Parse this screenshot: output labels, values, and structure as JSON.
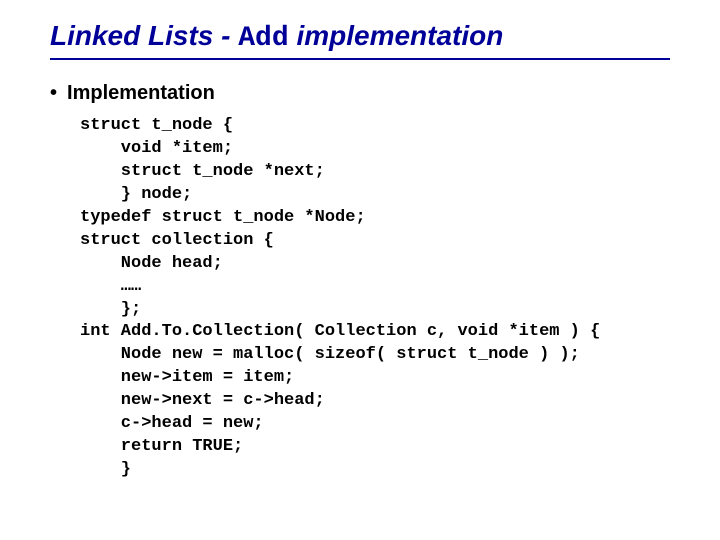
{
  "title": {
    "prefix": "Linked Lists - ",
    "mono": "Add",
    "suffix": " implementation"
  },
  "bullet": "Implementation",
  "code": "struct t_node {\n    void *item;\n    struct t_node *next;\n    } node;\ntypedef struct t_node *Node;\nstruct collection {\n    Node head;\n    ……\n    };\nint Add.To.Collection( Collection c, void *item ) {\n    Node new = malloc( sizeof( struct t_node ) );\n    new->item = item;\n    new->next = c->head;\n    c->head = new;\n    return TRUE;\n    }"
}
